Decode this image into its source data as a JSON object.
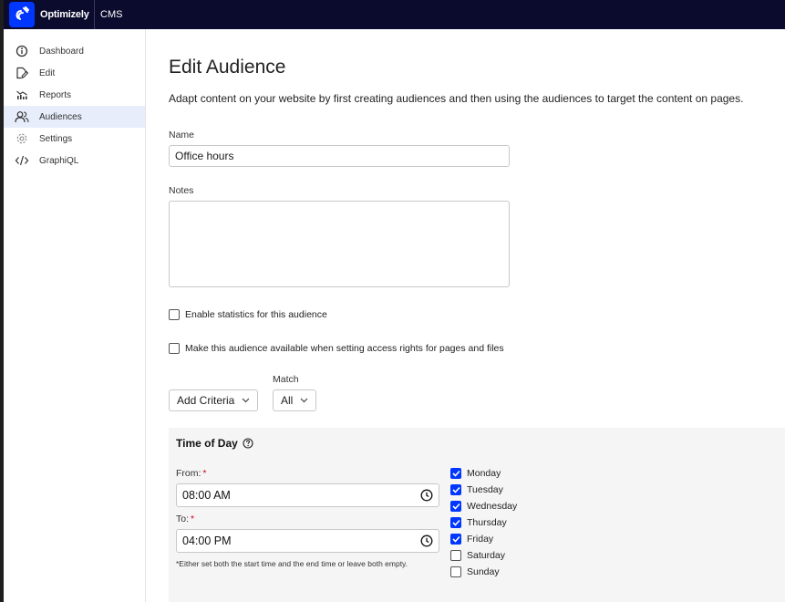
{
  "topbar": {
    "brand": "Optimizely",
    "product": "CMS"
  },
  "sidebar": {
    "items": [
      {
        "label": "Dashboard",
        "icon": "info-circle-icon"
      },
      {
        "label": "Edit",
        "icon": "edit-document-icon"
      },
      {
        "label": "Reports",
        "icon": "bar-chart-icon"
      },
      {
        "label": "Audiences",
        "icon": "users-icon",
        "active": true
      },
      {
        "label": "Settings",
        "icon": "gear-icon"
      },
      {
        "label": "GraphiQL",
        "icon": "code-icon"
      }
    ]
  },
  "page": {
    "title": "Edit Audience",
    "description": "Adapt content on your website by first creating audiences and then using the audiences to target the content on pages."
  },
  "form": {
    "name_label": "Name",
    "name_value": "Office hours",
    "notes_label": "Notes",
    "notes_value": "",
    "enable_statistics_label": "Enable statistics for this audience",
    "enable_statistics_checked": false,
    "access_rights_label": "Make this audience available when setting access rights for pages and files",
    "access_rights_checked": false,
    "add_criteria_label": "Add Criteria",
    "match_label": "Match",
    "match_value": "All"
  },
  "criteria": {
    "title": "Time of Day",
    "from_label": "From:",
    "from_value": "08:00 AM",
    "to_label": "To:",
    "to_value": "04:00 PM",
    "required_mark": "*",
    "hint": "*Either set both the start time and the end time or leave both empty.",
    "days": [
      {
        "label": "Monday",
        "checked": true
      },
      {
        "label": "Tuesday",
        "checked": true
      },
      {
        "label": "Wednesday",
        "checked": true
      },
      {
        "label": "Thursday",
        "checked": true
      },
      {
        "label": "Friday",
        "checked": true
      },
      {
        "label": "Saturday",
        "checked": false
      },
      {
        "label": "Sunday",
        "checked": false
      }
    ]
  },
  "colors": {
    "accent": "#0037ff",
    "topbar": "#0b0b2e",
    "active_nav": "#e8edfb"
  }
}
